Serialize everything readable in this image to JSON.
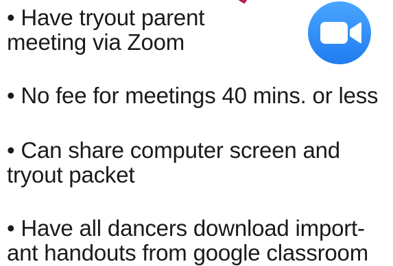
{
  "slide": {
    "bullets": [
      {
        "line1": "• Have tryout parent",
        "line2": "meeting via Zoom"
      },
      {
        "line1": "• No fee for meetings 40 mins. or less"
      },
      {
        "line1": "• Can share computer screen and",
        "line2": "tryout packet"
      },
      {
        "line1": "• Have all dancers download import-",
        "line2": "ant handouts from google classroom"
      }
    ],
    "logo": {
      "icon": "zoom-video-camera-icon",
      "color": "#2D8CFF"
    },
    "accent_shape_color": "#e0245e"
  }
}
